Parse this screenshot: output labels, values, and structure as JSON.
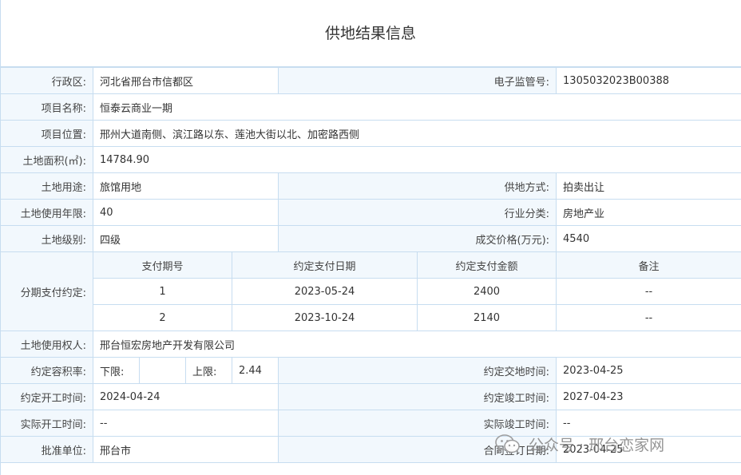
{
  "title": "供地结果信息",
  "rows": {
    "district_label": "行政区:",
    "district_value": "河北省邢台市信都区",
    "supervision_no_label": "电子监管号:",
    "supervision_no_value": "1305032023B00388",
    "project_name_label": "项目名称:",
    "project_name_value": "恒泰云商业一期",
    "location_label": "项目位置:",
    "location_value": "邢州大道南侧、滨江路以东、莲池大街以北、加密路西侧",
    "area_label": "土地面积(㎡):",
    "area_value": "14784.90",
    "use_label": "土地用途:",
    "use_value": "旅馆用地",
    "supply_method_label": "供地方式:",
    "supply_method_value": "拍卖出让",
    "years_label": "土地使用年限:",
    "years_value": "40",
    "industry_label": "行业分类:",
    "industry_value": "房地产业",
    "grade_label": "土地级别:",
    "grade_value": "四级",
    "price_label": "成交价格(万元):",
    "price_value": "4540",
    "installment_label": "分期支付约定:",
    "holder_label": "土地使用权人:",
    "holder_value": "邢台恒宏房地产开发有限公司",
    "far_label": "约定容积率:",
    "far_lower_label": "下限:",
    "far_lower_value": "",
    "far_upper_label": "上限:",
    "far_upper_value": "2.44",
    "delivery_label": "约定交地时间:",
    "delivery_value": "2023-04-25",
    "start_label": "约定开工时间:",
    "start_value": "2024-04-24",
    "completion_label": "约定竣工时间:",
    "completion_value": "2027-04-23",
    "actual_start_label": "实际开工时间:",
    "actual_start_value": "--",
    "actual_completion_label": "实际竣工时间:",
    "actual_completion_value": "--",
    "approver_label": "批准单位:",
    "approver_value": "邢台市",
    "contract_date_label": "合同签订日期:",
    "contract_date_value": "2023-04-25"
  },
  "installments": {
    "headers": [
      "支付期号",
      "约定支付日期",
      "约定支付金额",
      "备注"
    ],
    "items": [
      {
        "no": "1",
        "date": "2023-05-24",
        "amount": "2400",
        "note": "--"
      },
      {
        "no": "2",
        "date": "2023-10-24",
        "amount": "2140",
        "note": "--"
      }
    ]
  },
  "watermark": {
    "icon": "wechat-icon",
    "text": "公众号 · 邢台恋家网"
  },
  "colors": {
    "border": "#c7ddf0",
    "label_bg": "#f2f8fd"
  }
}
